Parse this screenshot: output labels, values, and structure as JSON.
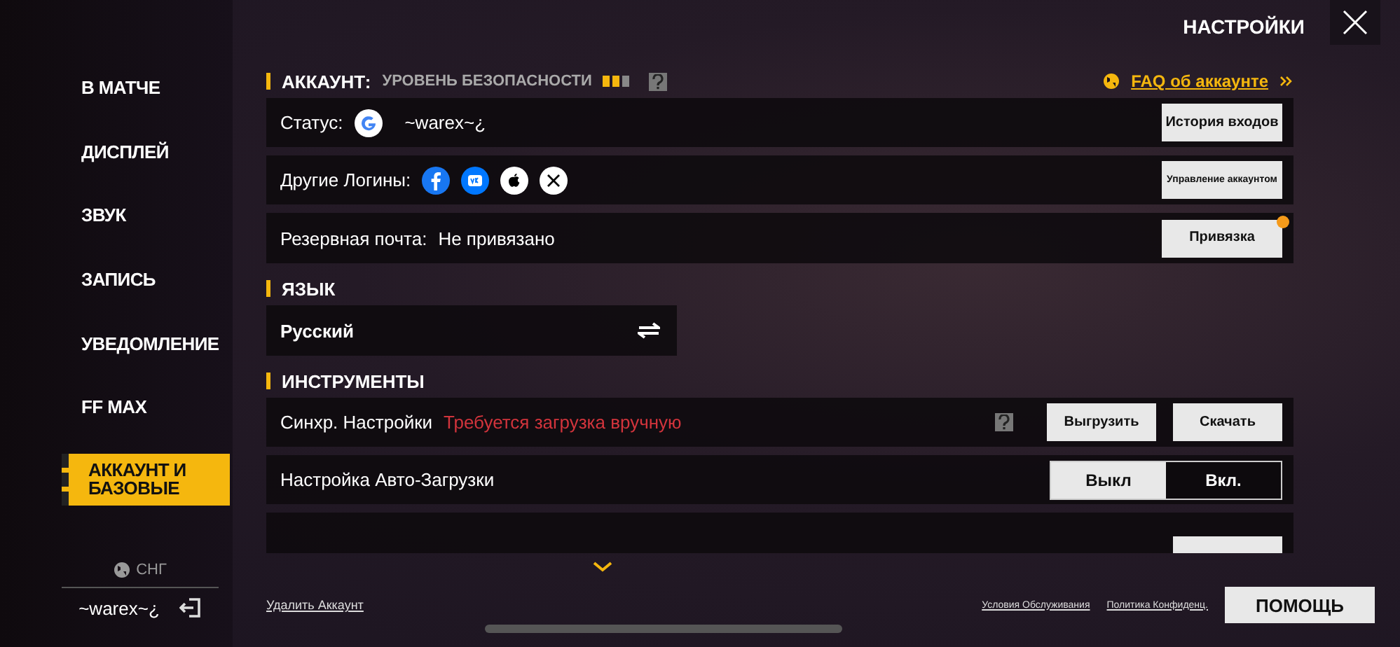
{
  "header": {
    "title": "НАСТРОЙКИ"
  },
  "sidebar": {
    "items": [
      {
        "label": "В МАТЧЕ",
        "selected": false
      },
      {
        "label": "ДИСПЛЕЙ",
        "selected": false
      },
      {
        "label": "ЗВУК",
        "selected": false
      },
      {
        "label": "ЗАПИСЬ",
        "selected": false
      },
      {
        "label": "УВЕДОМЛЕНИЕ",
        "selected": false
      },
      {
        "label": "FF MAX",
        "selected": false
      },
      {
        "label": "АККАУНТ И БАЗОВЫЕ",
        "selected": true
      }
    ],
    "region": "СНГ",
    "username": "~warex~¿"
  },
  "account": {
    "title": "АККАУНТ:",
    "security_label": "УРОВЕНЬ БЕЗОПАСНОСТИ",
    "security": {
      "level": 0.67
    },
    "faq_link": "FAQ об аккаунте",
    "rows": [
      {
        "kind": "status",
        "label": "Статус:",
        "value": "~warex~¿",
        "button": "История входов"
      },
      {
        "kind": "logins",
        "label": "Другие Логины:",
        "button": "Управление аккаунтом"
      },
      {
        "kind": "email",
        "label": "Резервная почта:",
        "value": "Не привязано",
        "button": "Привязка",
        "notify": true
      }
    ]
  },
  "language": {
    "title": "ЯЗЫК",
    "value": "Русский"
  },
  "tools": {
    "title": "ИНСТРУМЕНТЫ",
    "rows": [
      {
        "kind": "sync",
        "label": "Синхр. Настройки",
        "warning": "Требуется загрузка вручную",
        "buttons": [
          "Выгрузить",
          "Скачать"
        ]
      },
      {
        "kind": "toggle",
        "label": "Настройка Авто-Загрузки",
        "options": [
          {
            "label": "Выкл",
            "selected": true
          },
          {
            "label": "Вкл.",
            "selected": false
          }
        ]
      },
      {
        "kind": "partial"
      }
    ]
  },
  "footer": {
    "delete_link": "Удалить Аккаунт",
    "links": [
      "Условия Обслуживания",
      "Политика Конфиденц."
    ],
    "help_button": "ПОМОЩЬ"
  }
}
